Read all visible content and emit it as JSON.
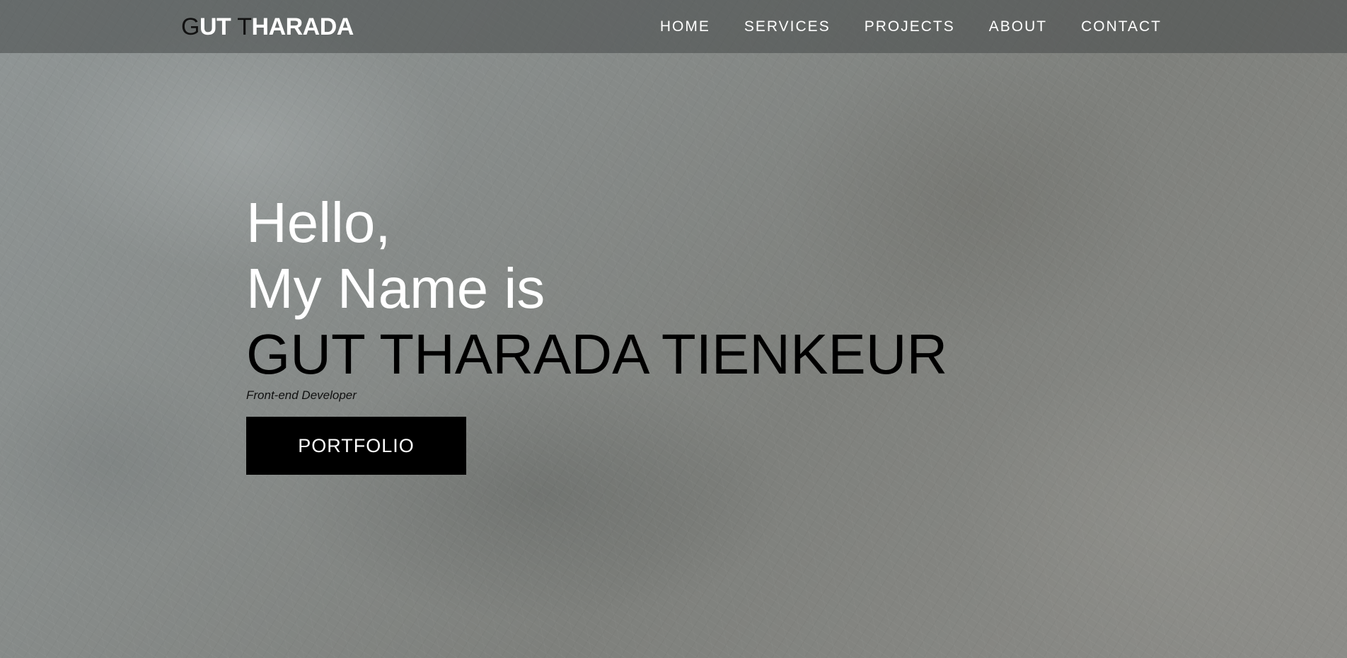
{
  "header": {
    "brand": {
      "initial_1": "G",
      "rest_1": "UT ",
      "initial_2": "T",
      "rest_2": "HARADA"
    },
    "nav": [
      {
        "label": "HOME"
      },
      {
        "label": "SERVICES"
      },
      {
        "label": "PROJECTS"
      },
      {
        "label": "ABOUT"
      },
      {
        "label": "CONTACT"
      }
    ]
  },
  "hero": {
    "greeting": "Hello,",
    "intro": "My Name is",
    "name": "GUT THARADA TIENKEUR",
    "role": "Front-end Developer",
    "button_label": "PORTFOLIO"
  },
  "colors": {
    "navbar_overlay": "#464848",
    "hero_text": "#ffffff",
    "name_text": "#000000",
    "button_bg": "#000000",
    "button_text": "#ffffff"
  }
}
